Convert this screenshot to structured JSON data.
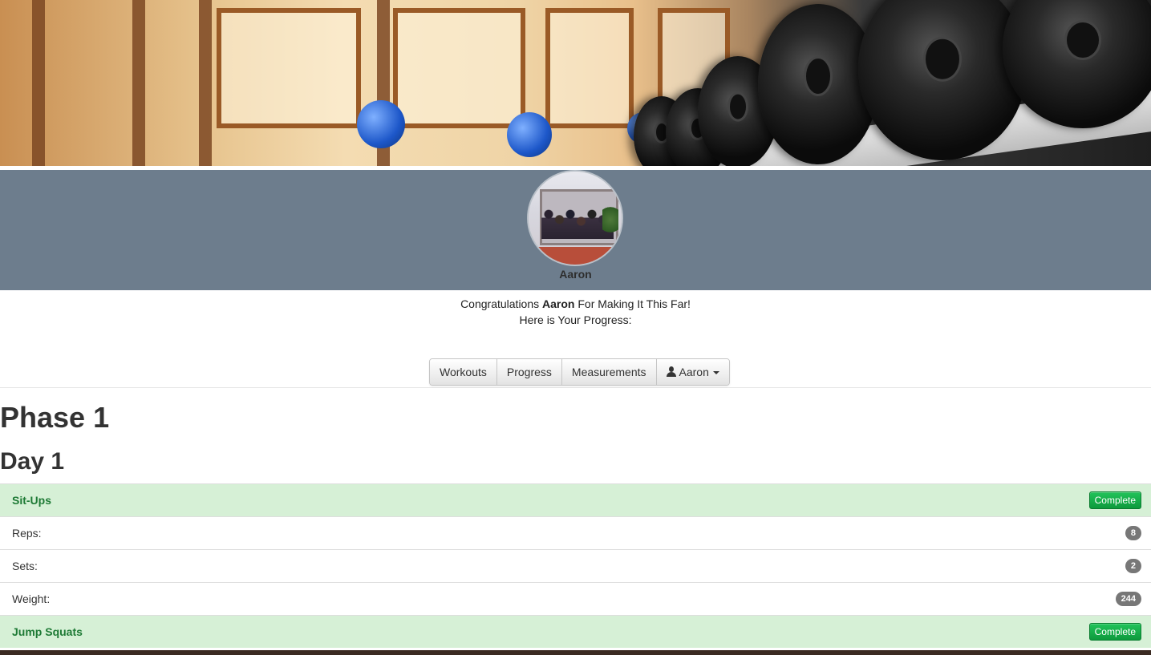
{
  "profile": {
    "name": "Aaron"
  },
  "congrats": {
    "prefix": "Congratulations ",
    "name": "Aaron",
    "suffix": " For Making It This Far!",
    "line2": "Here is Your Progress:"
  },
  "nav": {
    "workouts": "Workouts",
    "progress": "Progress",
    "measurements": "Measurements",
    "user": "Aaron",
    "user_icon": "user-icon",
    "caret_icon": "caret-down-icon"
  },
  "phase_title": "Phase 1",
  "day_title": "Day 1",
  "exercises": [
    {
      "name": "Sit-Ups",
      "action": "Complete",
      "stats": [
        {
          "label": "Reps:",
          "value": "8"
        },
        {
          "label": "Sets:",
          "value": "2"
        },
        {
          "label": "Weight:",
          "value": "244"
        }
      ]
    },
    {
      "name": "Jump Squats",
      "action": "Complete"
    }
  ],
  "colors": {
    "profile_band": "#6d7d8d",
    "exercise_row": "#d6f0d6",
    "exercise_text": "#1e7a35",
    "complete_button": "#0e9a3d",
    "badge": "#777777"
  }
}
